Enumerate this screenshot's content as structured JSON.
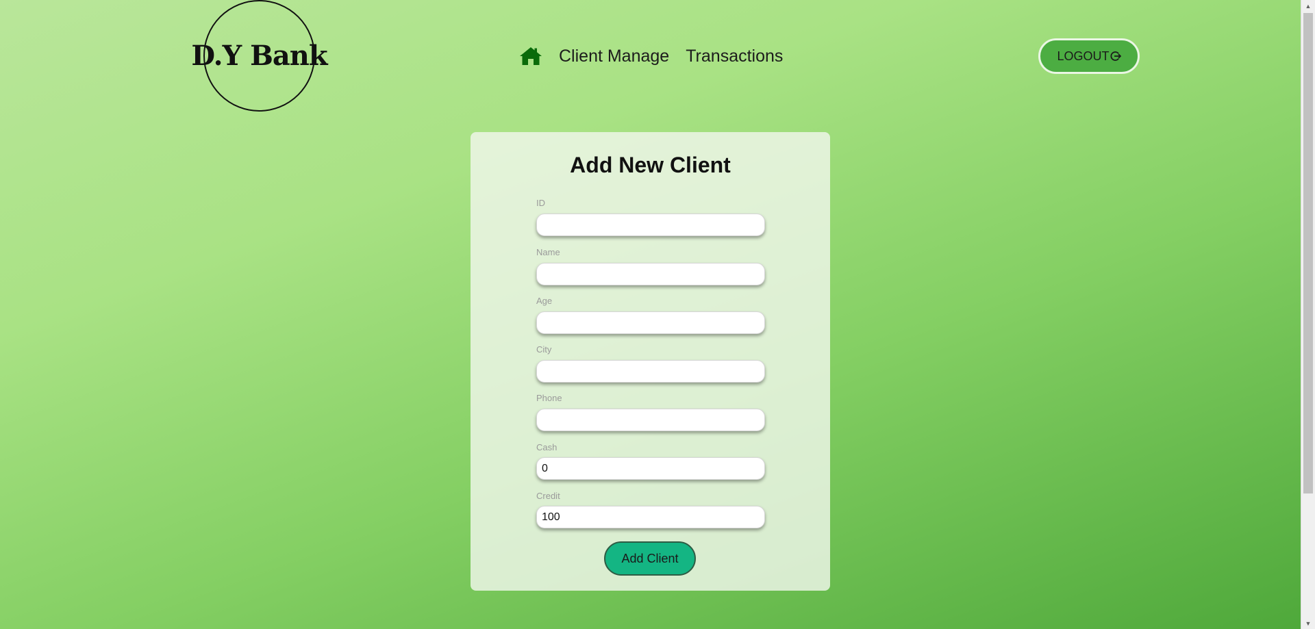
{
  "header": {
    "logo_text": "D.Y Bank",
    "nav": {
      "home_icon": "home-icon",
      "client_manage": "Client Manage",
      "transactions": "Transactions"
    },
    "logout_label": "LOGOUT",
    "logout_icon": "logout-icon"
  },
  "form": {
    "title": "Add New Client",
    "fields": {
      "id": {
        "label": "ID",
        "value": ""
      },
      "name": {
        "label": "Name",
        "value": ""
      },
      "age": {
        "label": "Age",
        "value": ""
      },
      "city": {
        "label": "City",
        "value": ""
      },
      "phone": {
        "label": "Phone",
        "value": ""
      },
      "cash": {
        "label": "Cash",
        "value": "0"
      },
      "credit": {
        "label": "Credit",
        "value": "100"
      }
    },
    "submit_label": "Add Client"
  },
  "colors": {
    "accent_green": "#0a6b0a",
    "submit_button": "#14b583",
    "logout_button": "#4cad42"
  }
}
